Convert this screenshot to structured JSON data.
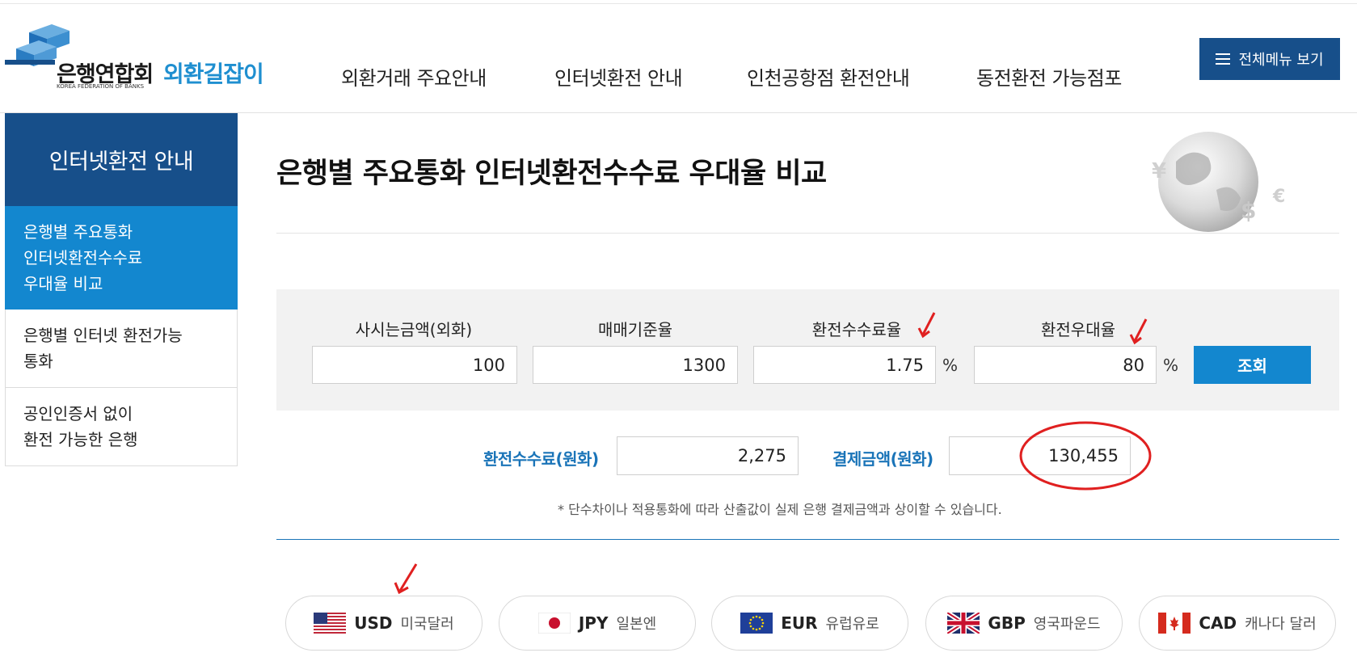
{
  "header": {
    "logo_kor": "은행연합회",
    "logo_eng": "KOREA FEDERATION OF BANKS",
    "logo_sub": "외환길잡이",
    "nav": [
      "외환거래 주요안내",
      "인터넷환전 안내",
      "인천공항점 환전안내",
      "동전환전 가능점포"
    ],
    "all_menu_label": "전체메뉴 보기"
  },
  "sidebar": {
    "title": "인터넷환전 안내",
    "items": [
      {
        "lines": [
          "은행별 주요통화",
          "인터넷환전수수료",
          "우대율 비교"
        ]
      },
      {
        "lines": [
          "은행별 인터넷 환전가능",
          "통화"
        ]
      },
      {
        "lines": [
          "공인인증서 없이",
          "환전 가능한 은행"
        ]
      }
    ]
  },
  "main": {
    "title": "은행별 주요통화 인터넷환전수수료 우대율 비교",
    "calc": {
      "labels": [
        "사시는금액(외화)",
        "매매기준율",
        "환전수수료율",
        "환전우대율"
      ],
      "amount": "100",
      "base_rate": "1300",
      "fee_rate": "1.75",
      "discount_rate": "80",
      "percent_symbol": "%",
      "query_label": "조회"
    },
    "result": {
      "fee_label": "환전수수료(원화)",
      "fee_value": "2,275",
      "pay_label": "결제금액(원화)",
      "pay_value": "130,455"
    },
    "note": "* 단수차이나 적용통화에 따라 산출값이 실제 은행 결제금액과 상이할 수 있습니다.",
    "currencies": [
      {
        "code": "USD",
        "name": "미국달러",
        "flag": "us-flag-icon"
      },
      {
        "code": "JPY",
        "name": "일본엔",
        "flag": "jp-flag-icon"
      },
      {
        "code": "EUR",
        "name": "유럽유로",
        "flag": "eu-flag-icon"
      },
      {
        "code": "GBP",
        "name": "영국파운드",
        "flag": "gb-flag-icon"
      },
      {
        "code": "CAD",
        "name": "캐나다 달러",
        "flag": "ca-flag-icon"
      }
    ]
  },
  "colors": {
    "primary_navy": "#174f8a",
    "accent_blue": "#1387cf",
    "annotation_red": "#e02020"
  }
}
